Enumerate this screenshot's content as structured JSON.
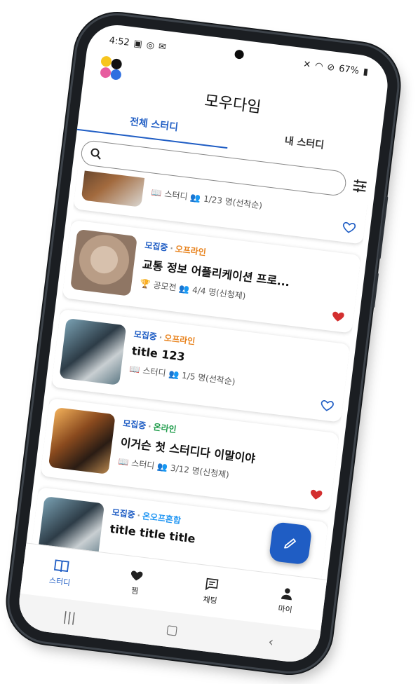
{
  "status_bar": {
    "time": "4:52",
    "battery": "67%"
  },
  "app": {
    "title": "모우다임"
  },
  "tabs": [
    {
      "label": "전체 스터디",
      "active": true
    },
    {
      "label": "내 스터디",
      "active": false
    }
  ],
  "search": {
    "placeholder": ""
  },
  "cards": [
    {
      "status": "",
      "mode": "",
      "title": "",
      "category": "스터디",
      "participants": "1/23 명(선착순)",
      "liked": false,
      "thumb": "desk-photo"
    },
    {
      "status": "모집중",
      "mode": "오프라인",
      "title": "교통 정보 어플리케이션 프로...",
      "category": "공모전",
      "participants": "4/4 명(신청제)",
      "liked": true,
      "thumb": "bunny-photo"
    },
    {
      "status": "모집중",
      "mode": "오프라인",
      "title": "title 123",
      "category": "스터디",
      "participants": "1/5 명(선착순)",
      "liked": false,
      "thumb": "workspace-photo"
    },
    {
      "status": "모집중",
      "mode": "온라인",
      "title": "이거슨 첫 스터디다 이말이야",
      "category": "스터디",
      "participants": "3/12 명(신청제)",
      "liked": true,
      "thumb": "laptop-photo"
    },
    {
      "status": "모집중",
      "mode": "온오프혼합",
      "title": "title title title",
      "category": "",
      "participants": "",
      "liked": false,
      "thumb": "workspace-photo"
    }
  ],
  "bottom_nav": [
    {
      "label": "스터디",
      "icon": "book-icon",
      "active": true
    },
    {
      "label": "찜",
      "icon": "heart-icon",
      "active": false
    },
    {
      "label": "채팅",
      "icon": "chat-icon",
      "active": false
    },
    {
      "label": "마이",
      "icon": "person-icon",
      "active": false
    }
  ],
  "colors": {
    "primary": "#1f5dc4",
    "offline": "#e8821c",
    "online": "#1e9c4a",
    "hybrid": "#2196f3",
    "heart": "#d32f2f"
  }
}
